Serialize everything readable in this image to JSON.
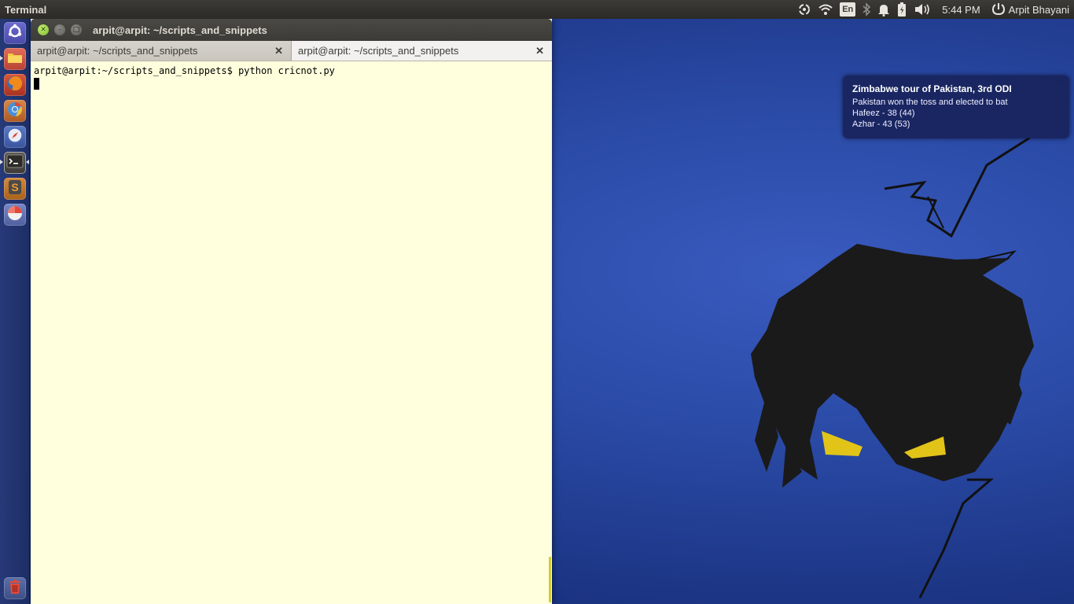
{
  "top_panel": {
    "app_name": "Terminal",
    "keyboard_layout": "En",
    "clock": "5:44 PM",
    "user_name": "Arpit Bhayani"
  },
  "launcher": {
    "items": [
      {
        "name": "dash-home",
        "icon": "ubuntu-logo-icon"
      },
      {
        "name": "files",
        "icon": "folder-icon"
      },
      {
        "name": "firefox",
        "icon": "firefox-icon"
      },
      {
        "name": "chromium",
        "icon": "chromium-icon"
      },
      {
        "name": "web-browser",
        "icon": "compass-icon"
      },
      {
        "name": "terminal",
        "icon": "terminal-icon"
      },
      {
        "name": "sublime-text",
        "icon": "sublime-icon"
      },
      {
        "name": "disk-usage",
        "icon": "pie-chart-icon"
      },
      {
        "name": "trash",
        "icon": "trash-icon"
      }
    ]
  },
  "terminal": {
    "window_title": "arpit@arpit: ~/scripts_and_snippets",
    "tabs": [
      {
        "label": "arpit@arpit: ~/scripts_and_snippets"
      },
      {
        "label": "arpit@arpit: ~/scripts_and_snippets"
      }
    ],
    "prompt_line": "arpit@arpit:~/scripts_and_snippets$ python cricnot.py"
  },
  "notification": {
    "title": "Zimbabwe tour of Pakistan, 3rd ODI",
    "lines": [
      "Pakistan won the toss and elected to bat",
      "Hafeez - 38 (44)",
      "Azhar - 43 (53)"
    ]
  },
  "colors": {
    "terminal_background": "#ffffdd",
    "panel": "#3c3b37",
    "notification_bg": "#19245c",
    "wallpaper_blue": "#2a4aa6"
  }
}
